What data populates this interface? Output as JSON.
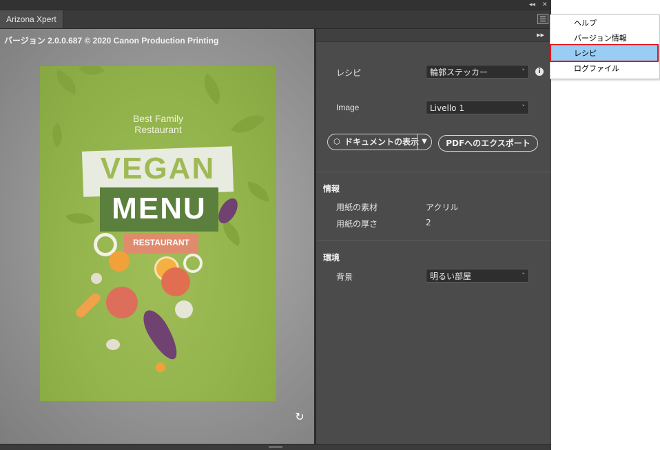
{
  "window": {
    "tab_title": "Arizona Xpert",
    "collapse_icon": "double-chevron-left-icon",
    "close_icon": "close-icon",
    "panel_menu_icon": "hamburger-menu-icon",
    "strip_collapse_glyph": "◂◂",
    "strip_close_glyph": "✕"
  },
  "preview": {
    "version_text": "バージョン 2.0.0.687 © 2020 Canon Production Printing",
    "poster": {
      "subtitle_line1": "Best Family",
      "subtitle_line2": "Restaurant",
      "title1": "VEGAN",
      "title2": "MENU",
      "tag": "RESTAURANT"
    },
    "refresh_glyph": "↻"
  },
  "panel": {
    "expand_glyph": "▸▸",
    "recipe_label": "レシピ",
    "recipe_value": "輪郭ステッカー",
    "image_label": "Image",
    "image_value": "Livello 1",
    "show_document_label": "ドキュメントの表示",
    "export_pdf_label": "PDFへのエクスポート",
    "info_section": "情報",
    "paper_material_label": "用紙の素材",
    "paper_material_value": "アクリル",
    "paper_thickness_label": "用紙の厚さ",
    "paper_thickness_value": "2",
    "env_section": "環境",
    "background_label": "背景",
    "background_value": "明るい部屋"
  },
  "popup_menu": {
    "items": [
      "ヘルプ",
      "バージョン情報",
      "レシピ",
      "ログファイル"
    ],
    "highlighted_index": 2
  },
  "colors": {
    "panel_bg": "#4b4b4b",
    "poster_green": "#8fb048",
    "highlight_blue": "#99cdf3",
    "annotation_red": "#e4161b"
  }
}
